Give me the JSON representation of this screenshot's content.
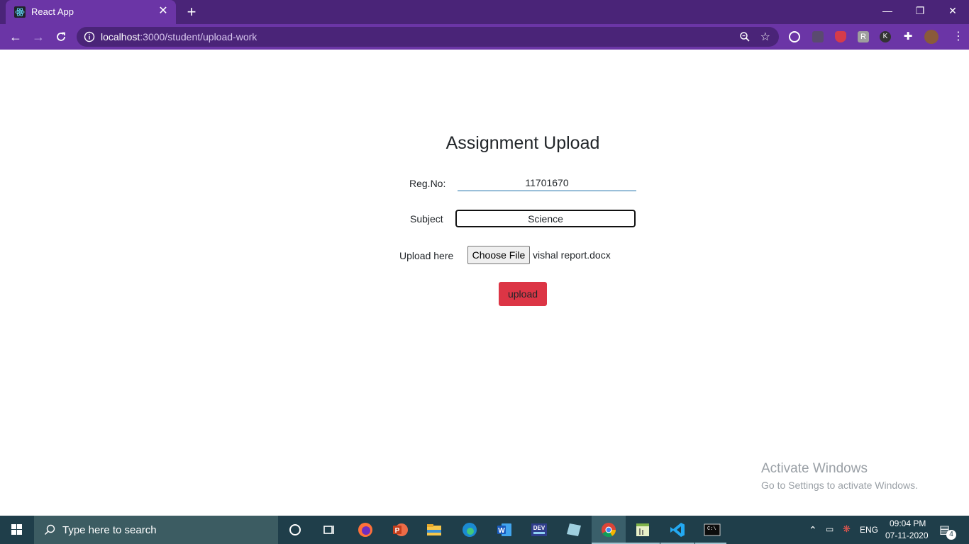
{
  "browser": {
    "tab_title": "React App",
    "tab_close": "✕",
    "new_tab": "+",
    "url_host": "localhost",
    "url_path": ":3000/student/upload-work",
    "window_controls": {
      "minimize": "—",
      "restore": "❐",
      "close": "✕"
    },
    "extensions": [
      "block-icon",
      "grid-extension-icon",
      "shield-extension-icon",
      "R-extension-icon",
      "K-extension-icon",
      "puzzle-icon",
      "profile-avatar"
    ]
  },
  "form": {
    "title": "Assignment Upload",
    "regno_label": "Reg.No:",
    "regno_value": "11701670",
    "subject_label": "Subject",
    "subject_value": "Science",
    "upload_label": "Upload here",
    "choose_file_label": "Choose File",
    "file_name": "vishal report.docx",
    "upload_button": "upload"
  },
  "watermark": {
    "title": "Activate Windows",
    "subtitle": "Go to Settings to activate Windows."
  },
  "taskbar": {
    "search_placeholder": "Type here to search",
    "language": "ENG",
    "time": "09:04 PM",
    "date": "07-11-2020",
    "notifications_count": "4",
    "apps": [
      "cortana-icon",
      "task-view-icon",
      "firefox-icon",
      "powerpoint-icon",
      "file-explorer-icon",
      "edge-icon",
      "word-icon",
      "dev-cpp-icon",
      "notes-icon",
      "chrome-icon",
      "editor-icon",
      "vscode-icon",
      "terminal-icon"
    ]
  },
  "colors": {
    "browser_frame": "#4a2478",
    "browser_toolbar": "#6b35a6",
    "upload_button": "#dc3545",
    "taskbar": "#1f3e4a"
  }
}
